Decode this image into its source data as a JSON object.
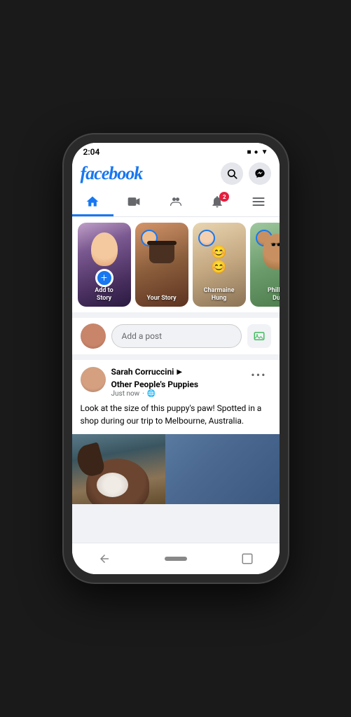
{
  "phone": {
    "status_bar": {
      "time": "2:04",
      "icons": [
        "■",
        "●",
        "▼"
      ]
    }
  },
  "header": {
    "logo": "facebook",
    "search_icon": "🔍",
    "messenger_icon": "⚡"
  },
  "nav": {
    "tabs": [
      {
        "label": "home",
        "icon": "home",
        "active": true
      },
      {
        "label": "video",
        "icon": "video",
        "active": false
      },
      {
        "label": "groups",
        "icon": "groups",
        "active": false
      },
      {
        "label": "notifications",
        "icon": "bell",
        "active": false,
        "badge": "2"
      },
      {
        "label": "menu",
        "icon": "menu",
        "active": false
      }
    ]
  },
  "stories": [
    {
      "id": 1,
      "label": "Add to\nStory",
      "type": "add"
    },
    {
      "id": 2,
      "label": "Your Story",
      "type": "user"
    },
    {
      "id": 3,
      "label": "Charmaine\nHung",
      "type": "user"
    },
    {
      "id": 4,
      "label": "Phillip\nDu",
      "type": "user"
    }
  ],
  "add_post": {
    "placeholder": "Add a post"
  },
  "post": {
    "author": "Sarah Corruccini",
    "arrow": "▶",
    "group": "Other People's Puppies",
    "timestamp": "Just now",
    "privacy": "🌐",
    "text": "Look at the size of this puppy's paw! Spotted in a shop during our trip to Melbourne, Australia.",
    "options": "•••"
  },
  "bottom_nav": {
    "back_icon": "◁",
    "home_btn": "",
    "square_icon": "□"
  }
}
